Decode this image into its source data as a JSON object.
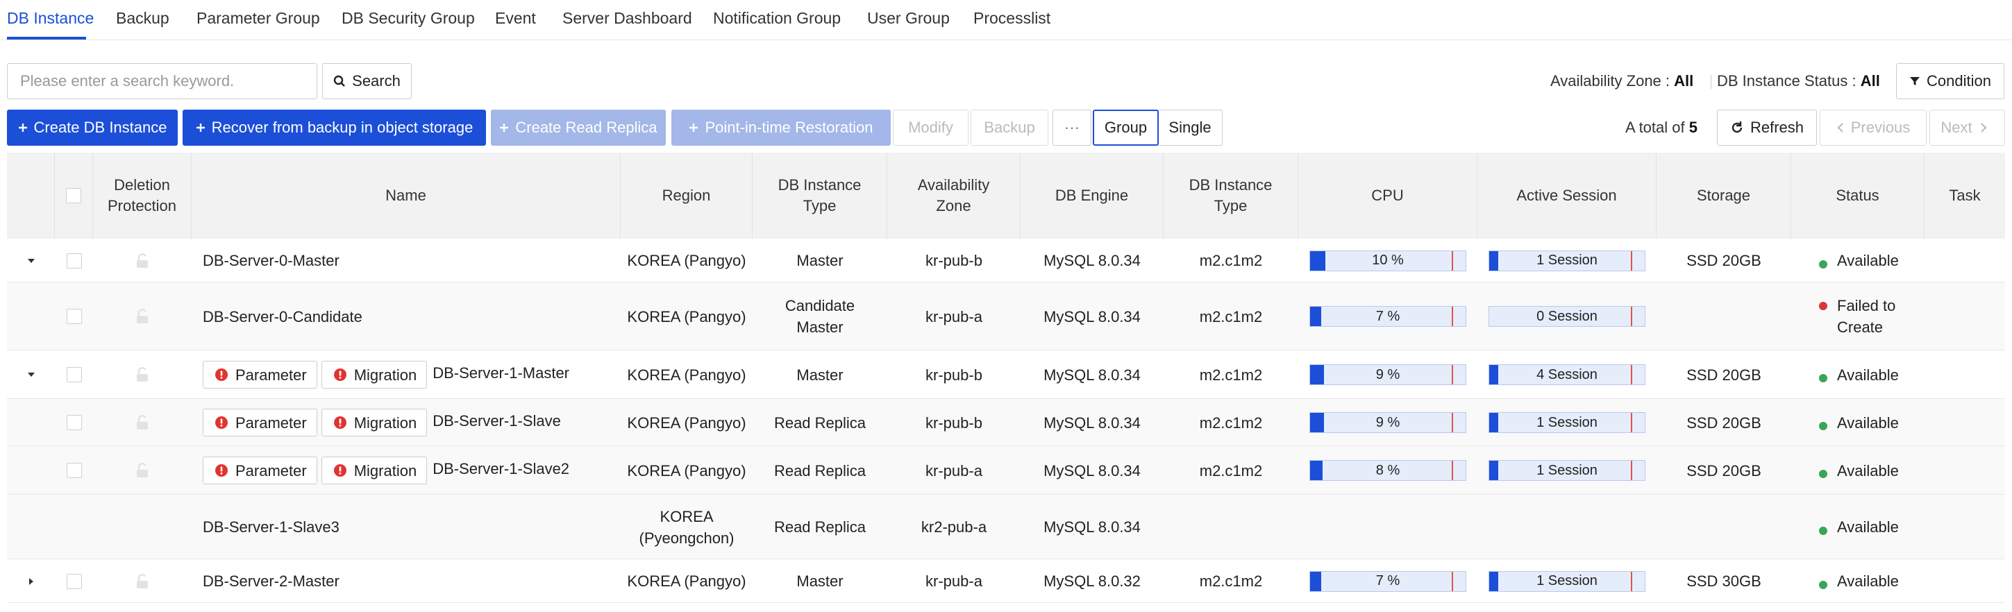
{
  "tabs": [
    {
      "label": "DB Instance",
      "active": true
    },
    {
      "label": "Backup"
    },
    {
      "label": "Parameter Group"
    },
    {
      "label": "DB Security Group"
    },
    {
      "label": "Event"
    },
    {
      "label": "Server Dashboard"
    },
    {
      "label": "Notification Group"
    },
    {
      "label": "User Group"
    },
    {
      "label": "Processlist"
    }
  ],
  "search": {
    "placeholder": "Please enter a search keyword.",
    "value": "",
    "button_label": "Search"
  },
  "filters": {
    "availability_zone_label": "Availability Zone",
    "availability_zone_value": "All",
    "instance_status_label": "DB Instance Status",
    "instance_status_value": "All",
    "separator": ":",
    "condition_label": "Condition"
  },
  "toolbar": {
    "create_label": "Create DB Instance",
    "recover_label": "Recover from backup in object storage",
    "read_replica_label": "Create Read Replica",
    "pitr_label": "Point-in-time Restoration",
    "modify_label": "Modify",
    "backup_label": "Backup",
    "more_label": "···",
    "group_label": "Group",
    "single_label": "Single"
  },
  "pagination": {
    "total_prefix": "A total of",
    "total_count": "5",
    "refresh_label": "Refresh",
    "previous_label": "Previous",
    "next_label": "Next"
  },
  "columns": {
    "deletion_protection": "Deletion Protection",
    "name": "Name",
    "region": "Region",
    "db_instance_type": "DB Instance Type",
    "availability_zone": "Availability Zone",
    "db_engine": "DB Engine",
    "db_instance_type_spec": "DB Instance Type",
    "cpu": "CPU",
    "active_session": "Active Session",
    "storage": "Storage",
    "status": "Status",
    "task": "Task"
  },
  "tag_labels": {
    "parameter": "Parameter",
    "migration": "Migration"
  },
  "colors": {
    "accent": "#1c4fd8",
    "status_available": "#3aa655",
    "status_failed": "#d93636",
    "warning": "#e0342f"
  },
  "rows": [
    {
      "expand": "down",
      "name": "DB-Server-0-Master",
      "tags": false,
      "region": "KOREA (Pangyo)",
      "type": "Master",
      "az": "kr-pub-b",
      "engine": "MySQL 8.0.34",
      "spec": "m2.c1m2",
      "cpu": "10 %",
      "cpu_pct": 10,
      "session": "1 Session",
      "session_pct": 1,
      "storage": "SSD 20GB",
      "status": "Available",
      "status_color": "#3aa655",
      "child": false,
      "lock": true,
      "checkbox": true
    },
    {
      "expand": "",
      "name": "DB-Server-0-Candidate",
      "tags": false,
      "region": "KOREA (Pangyo)",
      "type": "Candidate Master",
      "az": "kr-pub-a",
      "engine": "MySQL 8.0.34",
      "spec": "m2.c1m2",
      "cpu": "7 %",
      "cpu_pct": 7,
      "session": "0 Session",
      "session_pct": 0,
      "storage": "",
      "status": "Failed to Create",
      "status_color": "#d93636",
      "child": true,
      "lock": true,
      "checkbox": true
    },
    {
      "expand": "down",
      "name": "DB-Server-1-Master",
      "tags": true,
      "region": "KOREA (Pangyo)",
      "type": "Master",
      "az": "kr-pub-b",
      "engine": "MySQL 8.0.34",
      "spec": "m2.c1m2",
      "cpu": "9 %",
      "cpu_pct": 9,
      "session": "4 Session",
      "session_pct": 2,
      "storage": "SSD 20GB",
      "status": "Available",
      "status_color": "#3aa655",
      "child": false,
      "lock": true,
      "checkbox": true
    },
    {
      "expand": "",
      "name": "DB-Server-1-Slave",
      "tags": true,
      "region": "KOREA (Pangyo)",
      "type": "Read Replica",
      "az": "kr-pub-b",
      "engine": "MySQL 8.0.34",
      "spec": "m2.c1m2",
      "cpu": "9 %",
      "cpu_pct": 9,
      "session": "1 Session",
      "session_pct": 1,
      "storage": "SSD 20GB",
      "status": "Available",
      "status_color": "#3aa655",
      "child": true,
      "lock": true,
      "checkbox": true
    },
    {
      "expand": "",
      "name": "DB-Server-1-Slave2",
      "tags": true,
      "region": "KOREA (Pangyo)",
      "type": "Read Replica",
      "az": "kr-pub-a",
      "engine": "MySQL 8.0.34",
      "spec": "m2.c1m2",
      "cpu": "8 %",
      "cpu_pct": 8,
      "session": "1 Session",
      "session_pct": 1,
      "storage": "SSD 20GB",
      "status": "Available",
      "status_color": "#3aa655",
      "child": true,
      "lock": true,
      "checkbox": true
    },
    {
      "expand": "",
      "name": "DB-Server-1-Slave3",
      "tags": false,
      "region": "KOREA (Pyeongchon)",
      "type": "Read Replica",
      "az": "kr2-pub-a",
      "engine": "MySQL 8.0.34",
      "spec": "",
      "cpu": "",
      "session": "",
      "storage": "",
      "status": "Available",
      "status_color": "#3aa655",
      "child": true,
      "lock": false,
      "checkbox": false
    },
    {
      "expand": "right",
      "name": "DB-Server-2-Master",
      "tags": false,
      "region": "KOREA (Pangyo)",
      "type": "Master",
      "az": "kr-pub-a",
      "engine": "MySQL 8.0.32",
      "spec": "m2.c1m2",
      "cpu": "7 %",
      "cpu_pct": 7,
      "session": "1 Session",
      "session_pct": 1,
      "storage": "SSD 30GB",
      "status": "Available",
      "status_color": "#3aa655",
      "child": false,
      "lock": true,
      "checkbox": true
    }
  ]
}
